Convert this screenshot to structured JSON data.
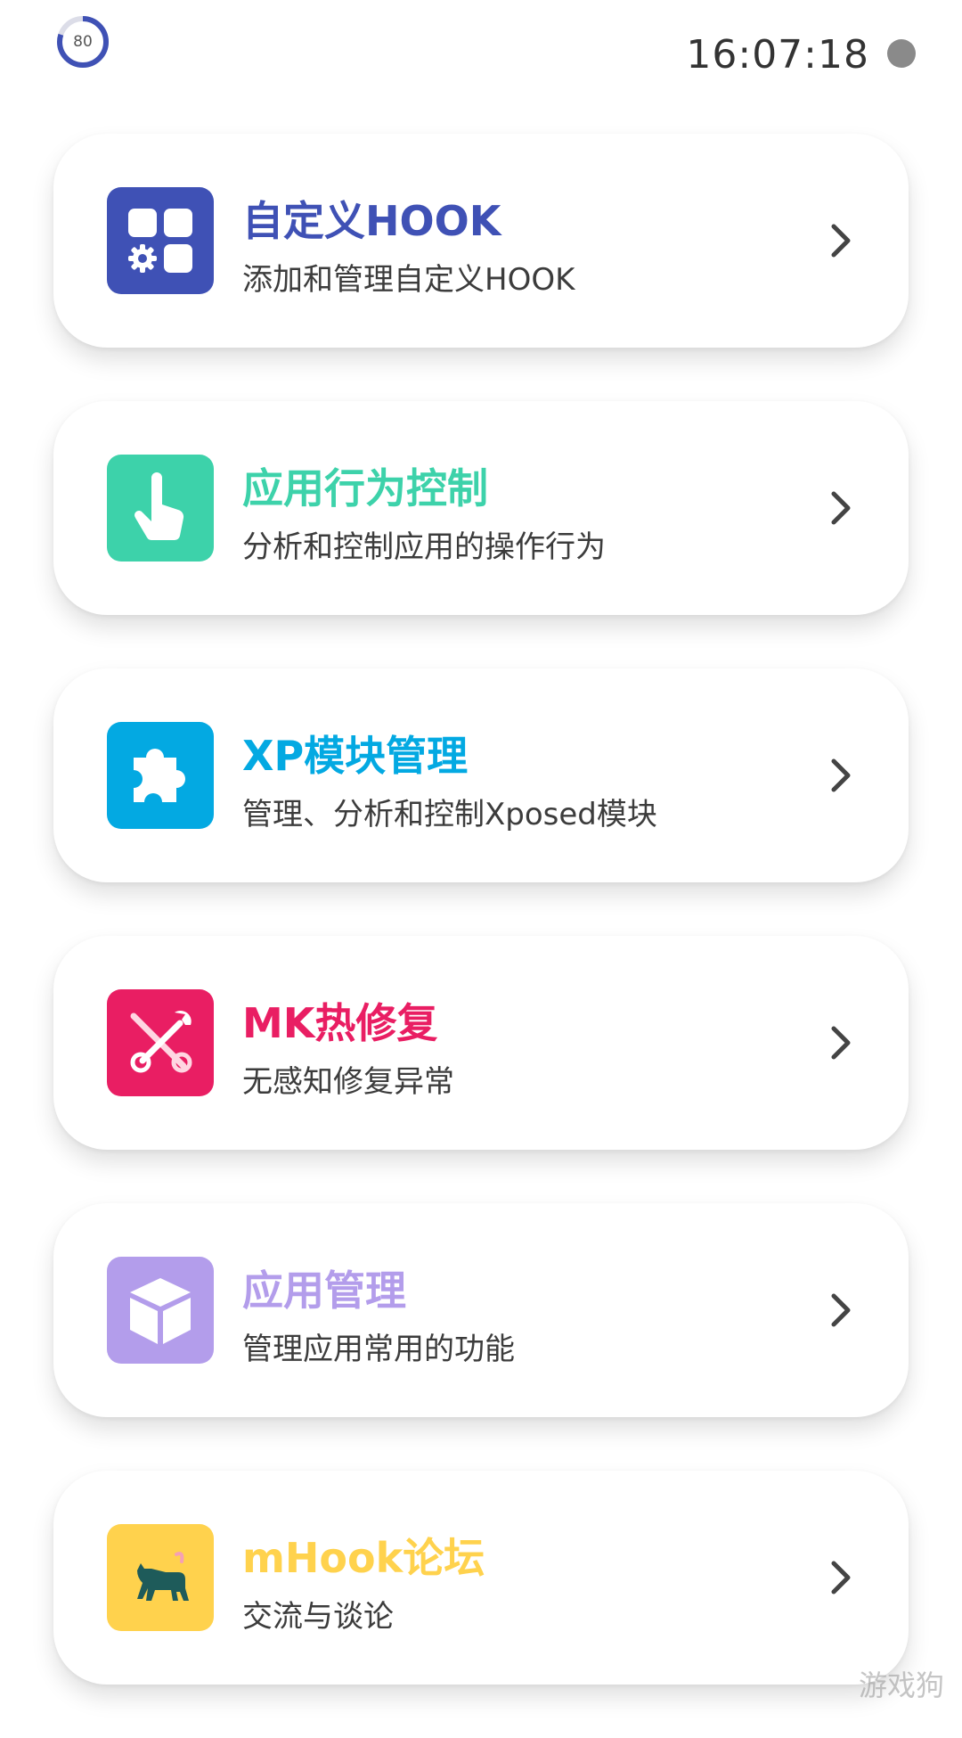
{
  "status_bar": {
    "battery_level": "80",
    "battery_fraction": 0.8,
    "time": "16:07:18"
  },
  "cards": [
    {
      "title": "自定义HOOK",
      "subtitle": "添加和管理自定义HOOK",
      "color": "#3F51B5",
      "icon": "apps-gear-icon"
    },
    {
      "title": "应用行为控制",
      "subtitle": "分析和控制应用的操作行为",
      "color": "#3DD2AA",
      "icon": "pointing-hand-icon"
    },
    {
      "title": "XP模块管理",
      "subtitle": "管理、分析和控制Xposed模块",
      "color": "#03A9E2",
      "icon": "puzzle-piece-icon"
    },
    {
      "title": "MK热修复",
      "subtitle": "无感知修复异常",
      "color": "#E91E63",
      "icon": "tools-icon"
    },
    {
      "title": "应用管理",
      "subtitle": "管理应用常用的功能",
      "color": "#B39DEB",
      "icon": "cube-icon"
    },
    {
      "title": "mHook论坛",
      "subtitle": "交流与谈论",
      "color": "#FFD24D",
      "icon": "cat-icon"
    }
  ],
  "watermark": "游戏狗"
}
